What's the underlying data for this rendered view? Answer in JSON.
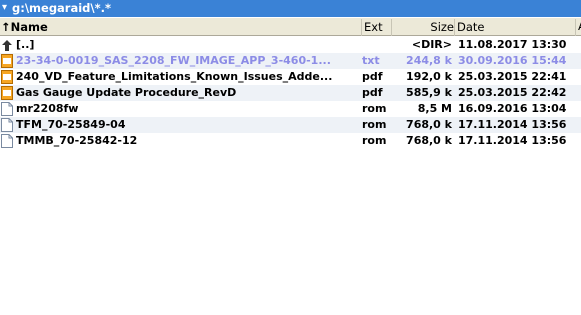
{
  "path_bar": {
    "path": "g:\\megaraid\\*.*"
  },
  "columns": {
    "name": "Name",
    "ext": "Ext",
    "size": "Size",
    "date": "Date",
    "attr": "A"
  },
  "files": [
    {
      "name": "[..]",
      "ext": "",
      "size": "<DIR>",
      "date": "11.08.2017 13:30",
      "icon": "up-arrow-icon",
      "selected": false
    },
    {
      "name": "23-34-0-0019_SAS_2208_FW_IMAGE_APP_3-460-1...",
      "ext": "txt",
      "size": "244,8 k",
      "date": "30.09.2016 15:44",
      "icon": "txt-file-icon",
      "selected": true
    },
    {
      "name": "240_VD_Feature_Limitations_Known_Issues_Adde...",
      "ext": "pdf",
      "size": "192,0 k",
      "date": "25.03.2015 22:41",
      "icon": "pdf-file-icon",
      "selected": false
    },
    {
      "name": "Gas Gauge Update Procedure_RevD",
      "ext": "pdf",
      "size": "585,9 k",
      "date": "25.03.2015 22:42",
      "icon": "pdf-file-icon",
      "selected": false
    },
    {
      "name": "mr2208fw",
      "ext": "rom",
      "size": "8,5 M",
      "date": "16.09.2016 13:04",
      "icon": "file-icon",
      "selected": false
    },
    {
      "name": "TFM_70-25849-04",
      "ext": "rom",
      "size": "768,0 k",
      "date": "17.11.2014 13:56",
      "icon": "file-icon",
      "selected": false
    },
    {
      "name": "TMMB_70-25842-12",
      "ext": "rom",
      "size": "768,0 k",
      "date": "17.11.2014 13:56",
      "icon": "file-icon",
      "selected": false
    }
  ]
}
